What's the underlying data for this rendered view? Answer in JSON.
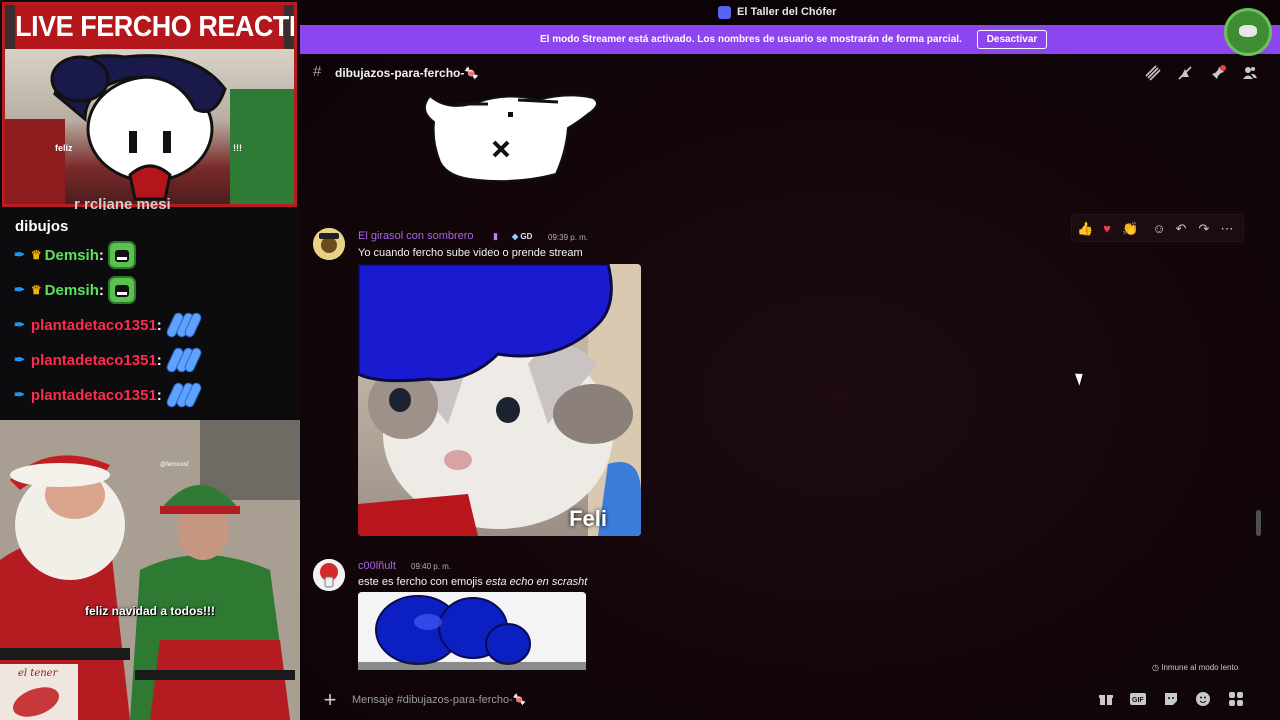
{
  "stream": {
    "title": "LIVE FERCHO REACTION",
    "cam_caption_left": "feliz",
    "cam_caption_right": "!!!",
    "chat": {
      "cut_line": "r rcljane mesi",
      "dibujos": "dibujos",
      "lines": [
        {
          "user": "Demsih",
          "badges": [
            "sword-icon",
            "crown-icon"
          ],
          "emote": "demon-emote",
          "color": "#5ee05e"
        },
        {
          "user": "Demsih",
          "badges": [
            "sword-icon",
            "crown-icon"
          ],
          "emote": "demon-emote",
          "color": "#5ee05e"
        },
        {
          "user": "plantadetaco1351",
          "badges": [
            "sword-icon"
          ],
          "emote": "wave-emote",
          "color": "#ff2a4e"
        },
        {
          "user": "plantadetaco1351",
          "badges": [
            "sword-icon"
          ],
          "emote": "wave-emote",
          "color": "#ff2a4e"
        },
        {
          "user": "plantadetaco1351",
          "badges": [
            "sword-icon"
          ],
          "emote": "wave-emote",
          "color": "#ff2a4e"
        }
      ]
    },
    "cam2_caption": "feliz navidad a todos!!!",
    "cam2_tag": "@fernxxisf",
    "logo_text": "el tener"
  },
  "app": {
    "window_title": "El Taller del Chófer",
    "streamer_mode_text": "El modo Streamer está activado. Los nombres de usuario se mostrarán de forma parcial.",
    "deactivate_label": "Desactivar",
    "channel_name": "dibujazos-para-fercho-🍬",
    "header_icons": [
      "threads-icon",
      "mute-icon",
      "pin-icon",
      "members-icon"
    ]
  },
  "messages": [
    {
      "author": "El girasol con sombrero",
      "tag": "GD",
      "time": "09:39 p. m.",
      "text": "Yo cuando fercho sube video o prende stream",
      "image_label": "Feli"
    },
    {
      "author": "c00lñult",
      "time": "09:40 p. m.",
      "text_plain": "este es fercho con emojis ",
      "text_italic": "esta echo en scrasht"
    }
  ],
  "hover_bar_icons": [
    "thumbs-up-icon",
    "heart-icon",
    "clap-icon",
    "add-reaction-icon",
    "reply-icon",
    "forward-icon",
    "more-icon"
  ],
  "slowmode_note": "Inmune al modo lento",
  "composer": {
    "placeholder": "Mensaje #dibujazos-para-fercho-🍬",
    "icons": [
      "gift-icon",
      "gif-icon",
      "sticker-icon",
      "emoji-icon",
      "apps-icon"
    ]
  }
}
